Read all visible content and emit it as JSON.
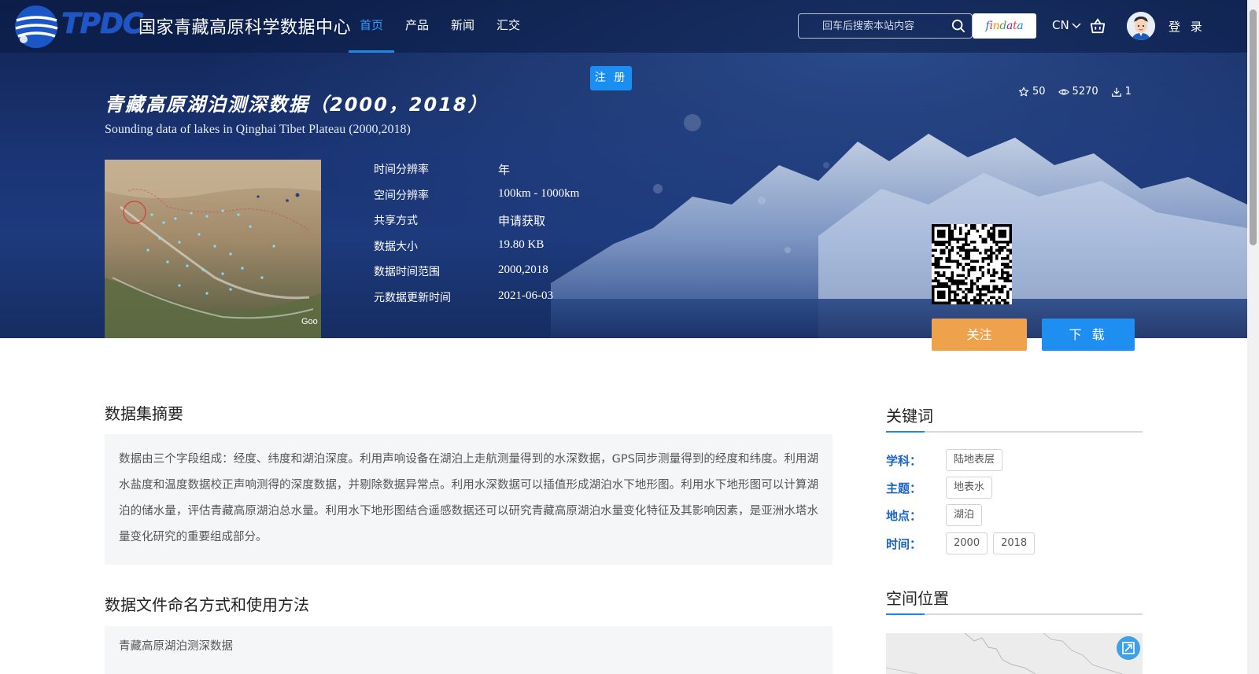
{
  "header": {
    "logo_text": "TPDC",
    "site_name": "国家青藏高原科学数据中心",
    "nav": [
      {
        "label": "首页",
        "active": true
      },
      {
        "label": "产品",
        "active": false
      },
      {
        "label": "新闻",
        "active": false
      },
      {
        "label": "汇交",
        "active": false
      }
    ],
    "search_placeholder": "回车后搜索本站内容",
    "findata_label": "findata",
    "language": "CN",
    "login_label": "登 录"
  },
  "register_label": "注 册",
  "dataset": {
    "title_cn": "青藏高原湖泊测深数据（2000，2018）",
    "title_en": "Sounding data of lakes in Qinghai Tibet Plateau (2000,2018)",
    "stats": {
      "stars": "50",
      "views": "5270",
      "downloads": "1"
    },
    "thumbnail_watermark": "Goo",
    "metadata": [
      {
        "label": "时间分辨率",
        "value": "年"
      },
      {
        "label": "空间分辨率",
        "value": "100km - 1000km"
      },
      {
        "label": "共享方式",
        "value": "申请获取"
      },
      {
        "label": "数据大小",
        "value": "19.80 KB"
      },
      {
        "label": "数据时间范围",
        "value": "2000,2018"
      },
      {
        "label": "元数据更新时间",
        "value": "2021-06-03"
      }
    ],
    "follow_label": "关注",
    "download_label": "下 载"
  },
  "abstract": {
    "title": "数据集摘要",
    "text": "数据由三个字段组成：经度、纬度和湖泊深度。利用声响设备在湖泊上走航测量得到的水深数据，GPS同步测量得到的经度和纬度。利用湖水盐度和温度数据校正声响测得的深度数据，并剔除数据异常点。利用水深数据可以插值形成湖泊水下地形图。利用水下地形图可以计算湖泊的储水量，评估青藏高原湖泊总水量。利用水下地形图结合遥感数据还可以研究青藏高原湖泊水量变化特征及其影响因素，是亚洲水塔水量变化研究的重要组成部分。"
  },
  "file_naming": {
    "title": "数据文件命名方式和使用方法",
    "text": "青藏高原湖泊测深数据"
  },
  "keywords": {
    "title": "关键词",
    "rows": [
      {
        "label": "学科：",
        "tags": [
          "陆地表层"
        ]
      },
      {
        "label": "主题：",
        "tags": [
          "地表水"
        ]
      },
      {
        "label": "地点：",
        "tags": [
          "湖泊"
        ]
      },
      {
        "label": "时间：",
        "tags": [
          "2000",
          "2018"
        ]
      }
    ]
  },
  "location": {
    "title": "空间位置"
  },
  "colors": {
    "accent": "#1e88e5",
    "follow": "#eda24b",
    "keyword_label": "#1a63c8"
  }
}
